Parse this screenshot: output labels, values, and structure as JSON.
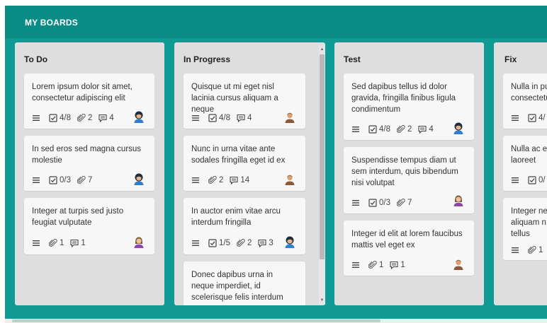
{
  "header": {
    "title": "MY BOARDS"
  },
  "columns": [
    {
      "title": "To Do",
      "cards": [
        {
          "text": "Lorem ipsum dolor sit amet, consectetur adipiscing elit",
          "checklist": "4/8",
          "attachments": "2",
          "comments": "4",
          "avatar": "avatar-dark-hair"
        },
        {
          "text": "In sed eros sed magna cursus molestie",
          "checklist": "0/3",
          "attachments": "7",
          "avatar": "avatar-dark-hair"
        },
        {
          "text": "Integer at turpis sed justo feugiat vulputate",
          "attachments": "1",
          "comments": "1",
          "avatar": "avatar-woman-purple"
        }
      ]
    },
    {
      "title": "In Progress",
      "cards": [
        {
          "text": "Quisque ut mi eget nisl lacinia cursus aliquam a neque",
          "checklist": "4/8",
          "comments": "4",
          "avatar": "avatar-man-brown"
        },
        {
          "text": "Nunc in urna vitae ante sodales fringilla eget id ex",
          "attachments": "2",
          "comments": "14",
          "avatar": "avatar-man-brown"
        },
        {
          "text": "In auctor enim vitae arcu interdum fringilla",
          "checklist": "1/5",
          "attachments": "2",
          "comments": "3",
          "avatar": "avatar-dark-hair"
        },
        {
          "text": "Donec dapibus urna in neque imperdiet, id scelerisque felis interdum"
        }
      ]
    },
    {
      "title": "Test",
      "cards": [
        {
          "text": "Sed dapibus tellus id dolor gravida, fringilla finibus ligula condimentum",
          "checklist": "4/8",
          "attachments": "2",
          "comments": "4",
          "avatar": "avatar-dark-hair"
        },
        {
          "text": "Suspendisse tempus diam ut sem interdum, quis bibendum nisi volutpat",
          "checklist": "0/3",
          "attachments": "7",
          "avatar": "avatar-woman-purple"
        },
        {
          "text": "Integer id elit at lorem faucibus mattis vel eget ex",
          "attachments": "1",
          "comments": "1",
          "avatar": "avatar-man-brown"
        }
      ]
    },
    {
      "title": "Fix",
      "cards": [
        {
          "text": "Nulla in pu\nconsectetu",
          "checklist": "4/"
        },
        {
          "text": "Nulla ac e\nlaoreet",
          "checklist": "0/"
        },
        {
          "text": "Integer ne\naliquam n\ntellus",
          "attachments": "1"
        }
      ]
    }
  ],
  "colors": {
    "header": "#0b8b86",
    "board_bg": "#0f9a94",
    "column_bg": "#dedede",
    "card_bg": "#f7f7f7"
  }
}
